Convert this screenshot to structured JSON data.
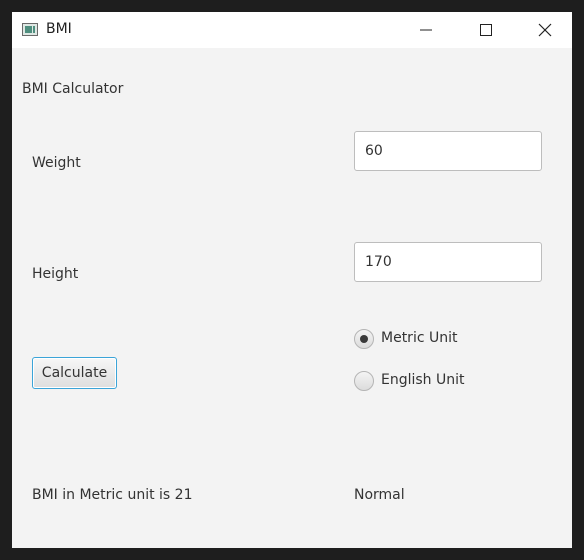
{
  "window": {
    "title": "BMI",
    "controls": {
      "minimize": "minimize",
      "maximize": "maximize",
      "close": "close"
    }
  },
  "app": {
    "heading": "BMI Calculator",
    "weight": {
      "label": "Weight",
      "value": "60"
    },
    "height": {
      "label": "Height",
      "value": "170"
    },
    "calculate_label": "Calculate",
    "units": {
      "selected": "Metric Unit",
      "options": [
        {
          "label": "Metric Unit",
          "checked": true
        },
        {
          "label": "English Unit",
          "checked": false
        }
      ]
    },
    "result": {
      "text": "BMI in Metric unit is 21",
      "classification": "Normal"
    }
  },
  "colors": {
    "window_bg": "#f3f3f3",
    "titlebar_bg": "#ffffff",
    "focus_border": "#3ba4d8"
  }
}
